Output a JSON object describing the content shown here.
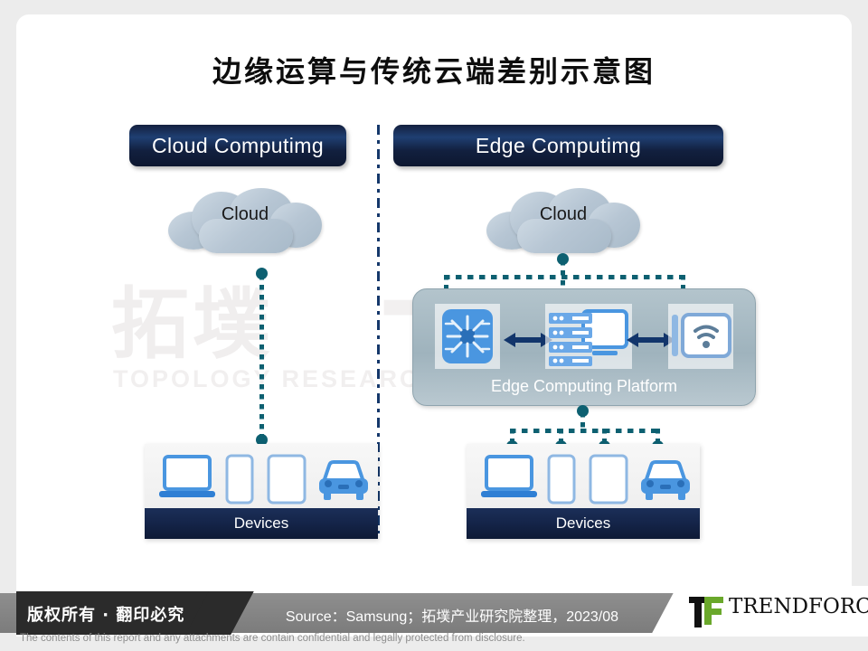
{
  "slide": {
    "title": "边缘运算与传统云端差别示意图",
    "watermark": {
      "cn": "拓墣",
      "en": "TOPOLOGY RESEARCH INSTITUTE",
      "big": "TRI"
    }
  },
  "sections": {
    "cloud": {
      "header": "Cloud Computimg",
      "cloud_label": "Cloud",
      "devices_label": "Devices",
      "devices": [
        "laptop-icon",
        "phone-icon",
        "tablet-icon",
        "car-icon"
      ]
    },
    "edge": {
      "header": "Edge Computimg",
      "cloud_label": "Cloud",
      "platform_label": "Edge Computing Platform",
      "platform_nodes": [
        "chip-icon",
        "server-icon",
        "wifi-icon"
      ],
      "devices_label": "Devices",
      "devices": [
        "laptop-icon",
        "phone-icon",
        "tablet-icon",
        "car-icon"
      ]
    }
  },
  "footer": {
    "copyright": "版权所有 · 翻印必究",
    "source": "Source：Samsung；拓墣产业研究院整理，2023/08",
    "brand": "TRENDFORCE",
    "disclaimer": "The contents of this report and any attachments are contain confidential and legally protected from disclosure."
  },
  "colors": {
    "header_navy": "#14203f",
    "connector_teal": "#0d6071",
    "cloud_gray_blue": "#b7c6d4",
    "platform_gray": "#9fb3bd",
    "device_blue": "#4a96e0",
    "accent_pink": "#d96a8c",
    "brand_green": "#6aa82b",
    "slide_bg": "#ffffff",
    "page_bg": "#ececec"
  }
}
